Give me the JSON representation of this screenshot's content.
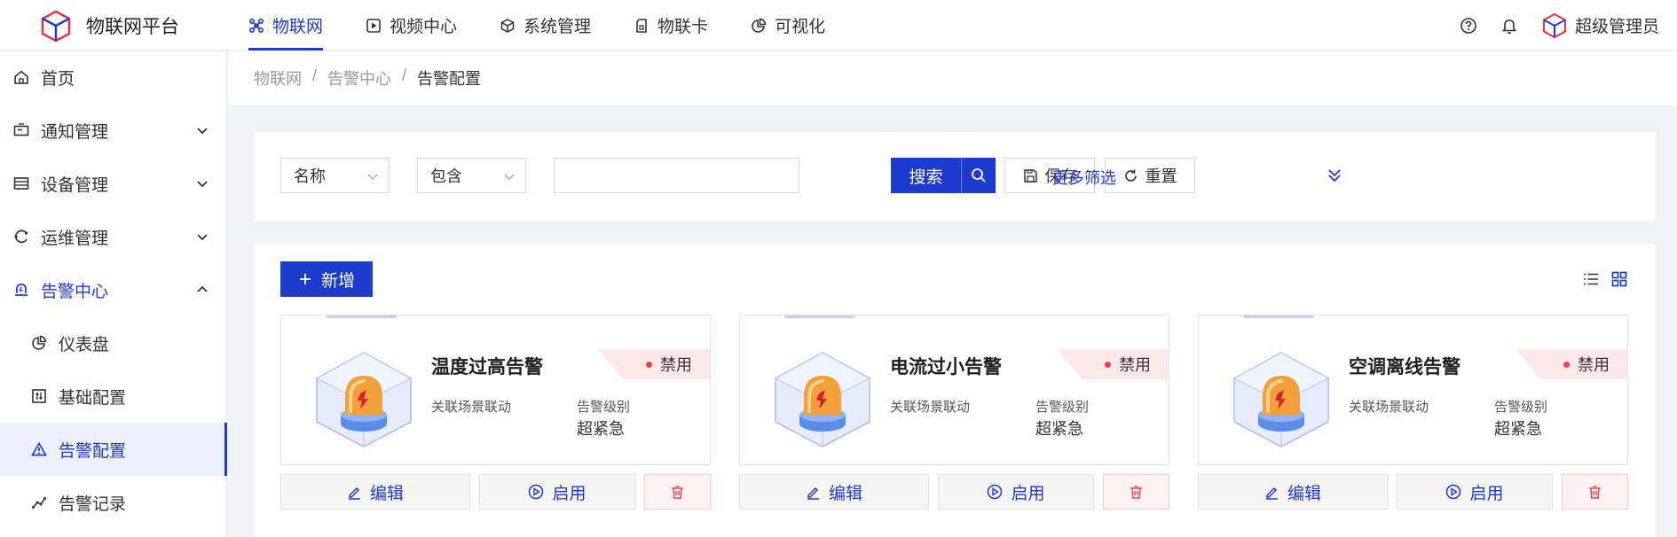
{
  "app": {
    "brand": "物联网平台"
  },
  "topnav": [
    {
      "label": "物联网",
      "icon": "iot-node-icon",
      "active": true
    },
    {
      "label": "视频中心",
      "icon": "video-play-icon",
      "active": false
    },
    {
      "label": "系统管理",
      "icon": "system-cube-icon",
      "active": false
    },
    {
      "label": "物联卡",
      "icon": "sim-card-icon",
      "active": false
    },
    {
      "label": "可视化",
      "icon": "pie-chart-icon",
      "active": false
    }
  ],
  "header": {
    "help_icon": "help-circle-icon",
    "bell_icon": "bell-icon",
    "user_name": "超级管理员"
  },
  "sidebar": {
    "items": [
      {
        "label": "首页",
        "icon": "home-icon"
      },
      {
        "label": "通知管理",
        "icon": "notice-icon"
      },
      {
        "label": "设备管理",
        "icon": "device-icon"
      },
      {
        "label": "运维管理",
        "icon": "ops-icon"
      },
      {
        "label": "告警中心",
        "icon": "alarm-bell-icon"
      },
      {
        "label": "仪表盘",
        "icon": "dashboard-pie-icon"
      },
      {
        "label": "基础配置",
        "icon": "basic-config-icon"
      },
      {
        "label": "告警配置",
        "icon": "warning-triangle-icon"
      },
      {
        "label": "告警记录",
        "icon": "record-line-icon"
      }
    ]
  },
  "breadcrumb": [
    "物联网",
    "/",
    "告警中心",
    "/",
    "告警配置"
  ],
  "filter": {
    "field": "名称",
    "operator": "包含",
    "value": "",
    "search_label": "搜索",
    "save_label": "保存",
    "reset_label": "重置",
    "more_label": "更多筛选"
  },
  "toolbar": {
    "add_label": "新增"
  },
  "cards": [
    {
      "title": "温度过高告警",
      "status": "禁用",
      "scene_label": "关联场景联动",
      "level_label": "告警级别",
      "level_value": "超紧急",
      "edit_label": "编辑",
      "enable_label": "启用"
    },
    {
      "title": "电流过小告警",
      "status": "禁用",
      "scene_label": "关联场景联动",
      "level_label": "告警级别",
      "level_value": "超紧急",
      "edit_label": "编辑",
      "enable_label": "启用"
    },
    {
      "title": "空调离线告警",
      "status": "禁用",
      "scene_label": "关联场景联动",
      "level_label": "告警级别",
      "level_value": "超紧急",
      "edit_label": "编辑",
      "enable_label": "启用"
    }
  ],
  "colors": {
    "primary": "#1f3bcb",
    "status_bg": "#fde8ea",
    "status_dot": "#f0424d",
    "danger": "#f0424d"
  }
}
